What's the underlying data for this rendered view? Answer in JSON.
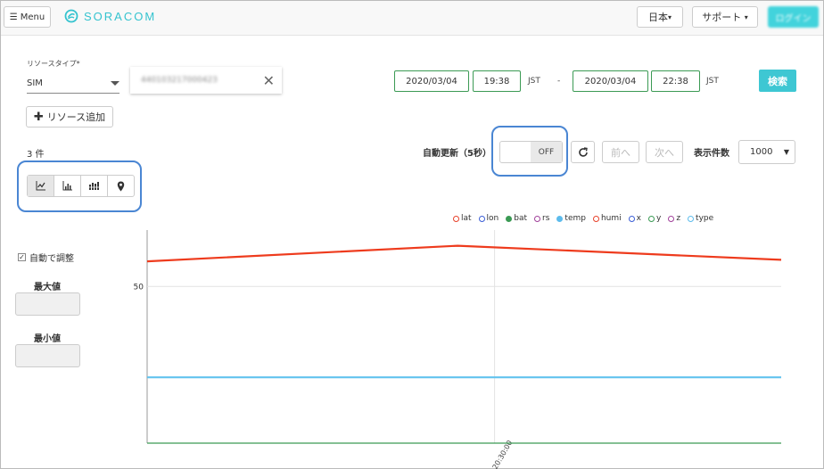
{
  "header": {
    "menu_label": "Menu",
    "logo_text": "SORACOM",
    "language_label": "日本",
    "support_label": "サポート",
    "login_label": "ログイン"
  },
  "filters": {
    "resource_type_label": "リソースタイプ*",
    "resource_type_value": "SIM",
    "resource_id_value": "440103217000423",
    "from_date": "2020/03/04",
    "from_time": "19:38",
    "from_tz": "JST",
    "separator": "-",
    "to_date": "2020/03/04",
    "to_time": "22:38",
    "to_tz": "JST",
    "search_label": "検索",
    "add_resource_label": "リソース追加"
  },
  "toolbar": {
    "count_label": "3 件",
    "auto_refresh_label": "自動更新（5秒）",
    "toggle_label": "OFF",
    "prev_label": "前へ",
    "next_label": "次へ",
    "per_page_label": "表示件数",
    "per_page_value": "1000"
  },
  "side": {
    "autofit_label": "自動で調整",
    "max_label": "最大値",
    "min_label": "最小値"
  },
  "colors": {
    "accent": "#3ec7d3",
    "green": "#3b9a54",
    "highlight": "#4a86d3"
  },
  "chart_data": {
    "type": "line",
    "legend": [
      {
        "name": "lat",
        "color": "#e8412a"
      },
      {
        "name": "lon",
        "color": "#3b5ed6"
      },
      {
        "name": "bat",
        "color": "#3b9a54"
      },
      {
        "name": "rs",
        "color": "#a0409a"
      },
      {
        "name": "temp",
        "color": "#5cbbec"
      },
      {
        "name": "humi",
        "color": "#e8412a"
      },
      {
        "name": "x",
        "color": "#3b5ed6"
      },
      {
        "name": "y",
        "color": "#3b9a54"
      },
      {
        "name": "z",
        "color": "#a0409a"
      },
      {
        "name": "type",
        "color": "#5cbbec"
      }
    ],
    "y_tick_labels": [
      "50"
    ],
    "x_tick_labels": [
      "20:30:00"
    ],
    "series": [
      {
        "name": "humi",
        "values": [
          58,
          63,
          58.5
        ],
        "color": "#ee3b1d"
      },
      {
        "name": "temp",
        "values": [
          21,
          21,
          21
        ],
        "color": "#62c3ee"
      },
      {
        "name": "bat",
        "values": [
          0,
          0,
          0
        ],
        "color": "#3b9a54"
      }
    ],
    "ylim": [
      0,
      68
    ],
    "grid": true
  }
}
